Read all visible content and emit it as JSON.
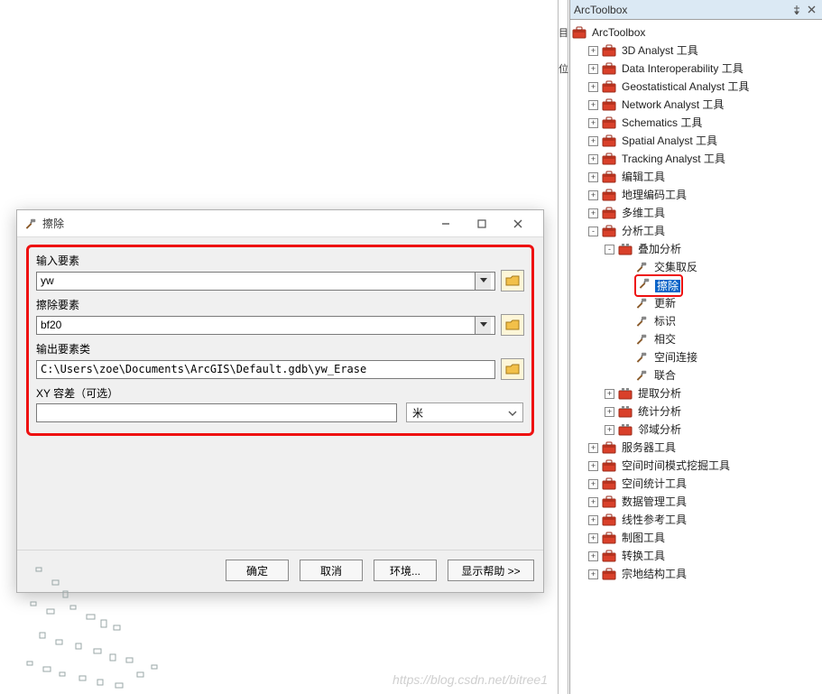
{
  "panel": {
    "title": "ArcToolbox",
    "pin_tooltip": "Pin",
    "close_tooltip": "Close"
  },
  "tree": {
    "root": "ArcToolbox",
    "items": [
      {
        "label": "3D Analyst 工具",
        "depth": 1,
        "exp": "+",
        "icon": "toolbox"
      },
      {
        "label": "Data Interoperability 工具",
        "depth": 1,
        "exp": "+",
        "icon": "toolbox"
      },
      {
        "label": "Geostatistical Analyst 工具",
        "depth": 1,
        "exp": "+",
        "icon": "toolbox"
      },
      {
        "label": "Network Analyst 工具",
        "depth": 1,
        "exp": "+",
        "icon": "toolbox"
      },
      {
        "label": "Schematics 工具",
        "depth": 1,
        "exp": "+",
        "icon": "toolbox"
      },
      {
        "label": "Spatial Analyst 工具",
        "depth": 1,
        "exp": "+",
        "icon": "toolbox"
      },
      {
        "label": "Tracking Analyst 工具",
        "depth": 1,
        "exp": "+",
        "icon": "toolbox"
      },
      {
        "label": "编辑工具",
        "depth": 1,
        "exp": "+",
        "icon": "toolbox"
      },
      {
        "label": "地理编码工具",
        "depth": 1,
        "exp": "+",
        "icon": "toolbox"
      },
      {
        "label": "多维工具",
        "depth": 1,
        "exp": "+",
        "icon": "toolbox"
      },
      {
        "label": "分析工具",
        "depth": 1,
        "exp": "-",
        "icon": "toolbox"
      },
      {
        "label": "叠加分析",
        "depth": 2,
        "exp": "-",
        "icon": "toolset"
      },
      {
        "label": "交集取反",
        "depth": 3,
        "exp": "",
        "icon": "hammer"
      },
      {
        "label": "擦除",
        "depth": 3,
        "exp": "",
        "icon": "hammer",
        "selected": true,
        "boxed": true
      },
      {
        "label": "更新",
        "depth": 3,
        "exp": "",
        "icon": "hammer"
      },
      {
        "label": "标识",
        "depth": 3,
        "exp": "",
        "icon": "hammer"
      },
      {
        "label": "相交",
        "depth": 3,
        "exp": "",
        "icon": "hammer"
      },
      {
        "label": "空间连接",
        "depth": 3,
        "exp": "",
        "icon": "hammer"
      },
      {
        "label": "联合",
        "depth": 3,
        "exp": "",
        "icon": "hammer"
      },
      {
        "label": "提取分析",
        "depth": 2,
        "exp": "+",
        "icon": "toolset"
      },
      {
        "label": "统计分析",
        "depth": 2,
        "exp": "+",
        "icon": "toolset"
      },
      {
        "label": "邻域分析",
        "depth": 2,
        "exp": "+",
        "icon": "toolset"
      },
      {
        "label": "服务器工具",
        "depth": 1,
        "exp": "+",
        "icon": "toolbox"
      },
      {
        "label": "空间时间模式挖掘工具",
        "depth": 1,
        "exp": "+",
        "icon": "toolbox"
      },
      {
        "label": "空间统计工具",
        "depth": 1,
        "exp": "+",
        "icon": "toolbox"
      },
      {
        "label": "数据管理工具",
        "depth": 1,
        "exp": "+",
        "icon": "toolbox"
      },
      {
        "label": "线性参考工具",
        "depth": 1,
        "exp": "+",
        "icon": "toolbox"
      },
      {
        "label": "制图工具",
        "depth": 1,
        "exp": "+",
        "icon": "toolbox"
      },
      {
        "label": "转换工具",
        "depth": 1,
        "exp": "+",
        "icon": "toolbox"
      },
      {
        "label": "宗地结构工具",
        "depth": 1,
        "exp": "+",
        "icon": "toolbox"
      }
    ]
  },
  "dialog": {
    "title": "擦除",
    "input_features_label": "输入要素",
    "input_features_value": "yw",
    "erase_features_label": "擦除要素",
    "erase_features_value": "bf20",
    "output_class_label": "输出要素类",
    "output_class_value": "C:\\Users\\zoe\\Documents\\ArcGIS\\Default.gdb\\yw_Erase",
    "xy_tolerance_label": "XY 容差（可选）",
    "xy_tolerance_value": "",
    "unit_value": "米",
    "buttons": {
      "ok": "确定",
      "cancel": "取消",
      "env": "环境...",
      "help": "显示帮助 >>"
    }
  },
  "sliver_chars": [
    "目",
    "",
    "位"
  ],
  "watermark": "https://blog.csdn.net/bitree1"
}
